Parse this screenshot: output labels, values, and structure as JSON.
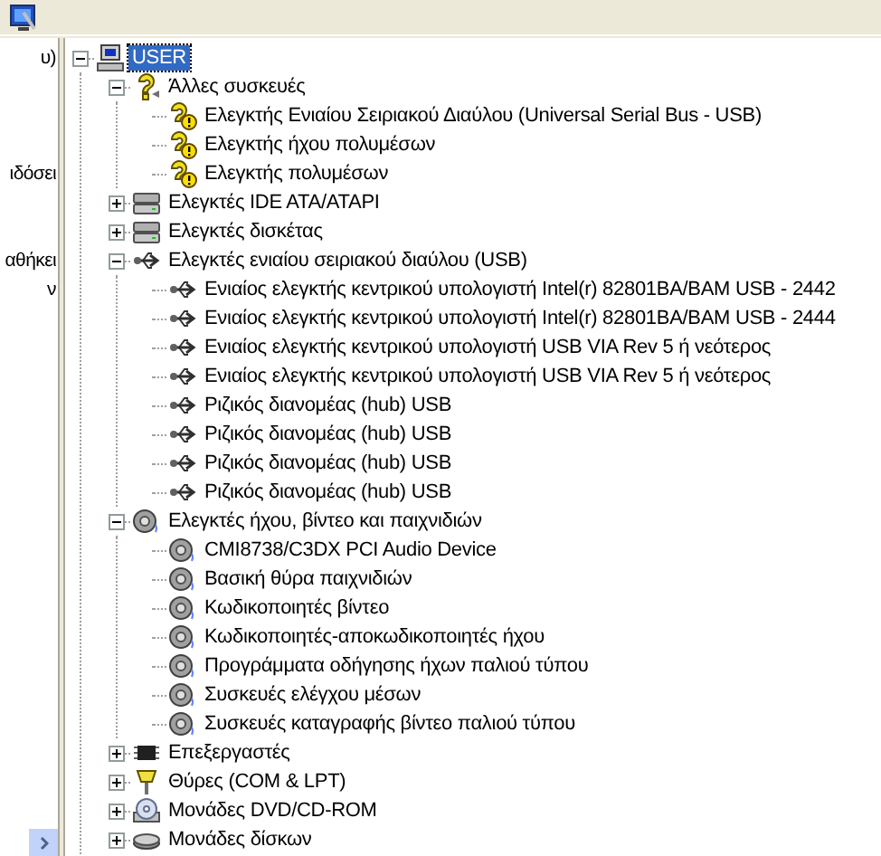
{
  "left_pane": {
    "texts": [
      "υ)",
      "ιδόσει",
      "αθήκει",
      "ν"
    ]
  },
  "tree": [
    {
      "label": "USER",
      "kind": "computer",
      "selected": true,
      "expanded": true,
      "children": [
        {
          "label": "Άλλες συσκευές",
          "kind": "question",
          "selected": false,
          "expanded": true,
          "children": [
            {
              "label": "Ελεγκτής Ενιαίου Σειριακού Διαύλου (Universal Serial Bus - USB)",
              "kind": "warning",
              "selected": false
            },
            {
              "label": "Ελεγκτής ήχου πολυμέσων",
              "kind": "warning",
              "selected": false
            },
            {
              "label": "Ελεγκτής πολυμέσων",
              "kind": "warning",
              "selected": false
            }
          ]
        },
        {
          "label": "Ελεγκτές IDE ATA/ATAPI",
          "kind": "drive",
          "selected": false,
          "expanded": false
        },
        {
          "label": "Ελεγκτές δισκέτας",
          "kind": "drive",
          "selected": false,
          "expanded": false
        },
        {
          "label": "Ελεγκτές ενιαίου σειριακού διαύλου (USB)",
          "kind": "usb",
          "selected": false,
          "expanded": true,
          "children": [
            {
              "label": "Ενιαίος ελεγκτής κεντρικού υπολογιστή Intel(r) 82801BA/BAM USB - 2442",
              "kind": "usb",
              "selected": false
            },
            {
              "label": "Ενιαίος ελεγκτής κεντρικού υπολογιστή Intel(r) 82801BA/BAM USB - 2444",
              "kind": "usb",
              "selected": false
            },
            {
              "label": "Ενιαίος ελεγκτής κεντρικού υπολογιστή USB VIA Rev 5 ή νεότερος",
              "kind": "usb",
              "selected": false
            },
            {
              "label": "Ενιαίος ελεγκτής κεντρικού υπολογιστή USB VIA Rev 5 ή νεότερος",
              "kind": "usb",
              "selected": false
            },
            {
              "label": "Ριζικός διανομέας (hub) USB",
              "kind": "usb",
              "selected": false
            },
            {
              "label": "Ριζικός διανομέας (hub) USB",
              "kind": "usb",
              "selected": false
            },
            {
              "label": "Ριζικός διανομέας (hub) USB",
              "kind": "usb",
              "selected": false
            },
            {
              "label": "Ριζικός διανομέας (hub) USB",
              "kind": "usb",
              "selected": false
            }
          ]
        },
        {
          "label": "Ελεγκτές ήχου, βίντεο και παιχνιδιών",
          "kind": "speaker",
          "selected": false,
          "expanded": true,
          "children": [
            {
              "label": "CMI8738/C3DX PCI Audio Device",
              "kind": "speaker",
              "selected": false
            },
            {
              "label": "Βασική θύρα παιχνιδιών",
              "kind": "speaker",
              "selected": false
            },
            {
              "label": "Κωδικοποιητές βίντεο",
              "kind": "speaker",
              "selected": false
            },
            {
              "label": "Κωδικοποιητές-αποκωδικοποιητές ήχου",
              "kind": "speaker",
              "selected": false
            },
            {
              "label": "Προγράμματα οδήγησης ήχων παλιού τύπου",
              "kind": "speaker",
              "selected": false
            },
            {
              "label": "Συσκευές ελέγχου μέσων",
              "kind": "speaker",
              "selected": false
            },
            {
              "label": "Συσκευές καταγραφής βίντεο παλιού τύπου",
              "kind": "speaker",
              "selected": false
            }
          ]
        },
        {
          "label": "Επεξεργαστές",
          "kind": "chip",
          "selected": false,
          "expanded": false
        },
        {
          "label": "Θύρες (COM & LPT)",
          "kind": "port",
          "selected": false,
          "expanded": false
        },
        {
          "label": "Μονάδες DVD/CD-ROM",
          "kind": "cd",
          "selected": false,
          "expanded": false
        },
        {
          "label": "Μονάδες δίσκων",
          "kind": "disk",
          "selected": false,
          "expanded": false
        }
      ]
    }
  ]
}
